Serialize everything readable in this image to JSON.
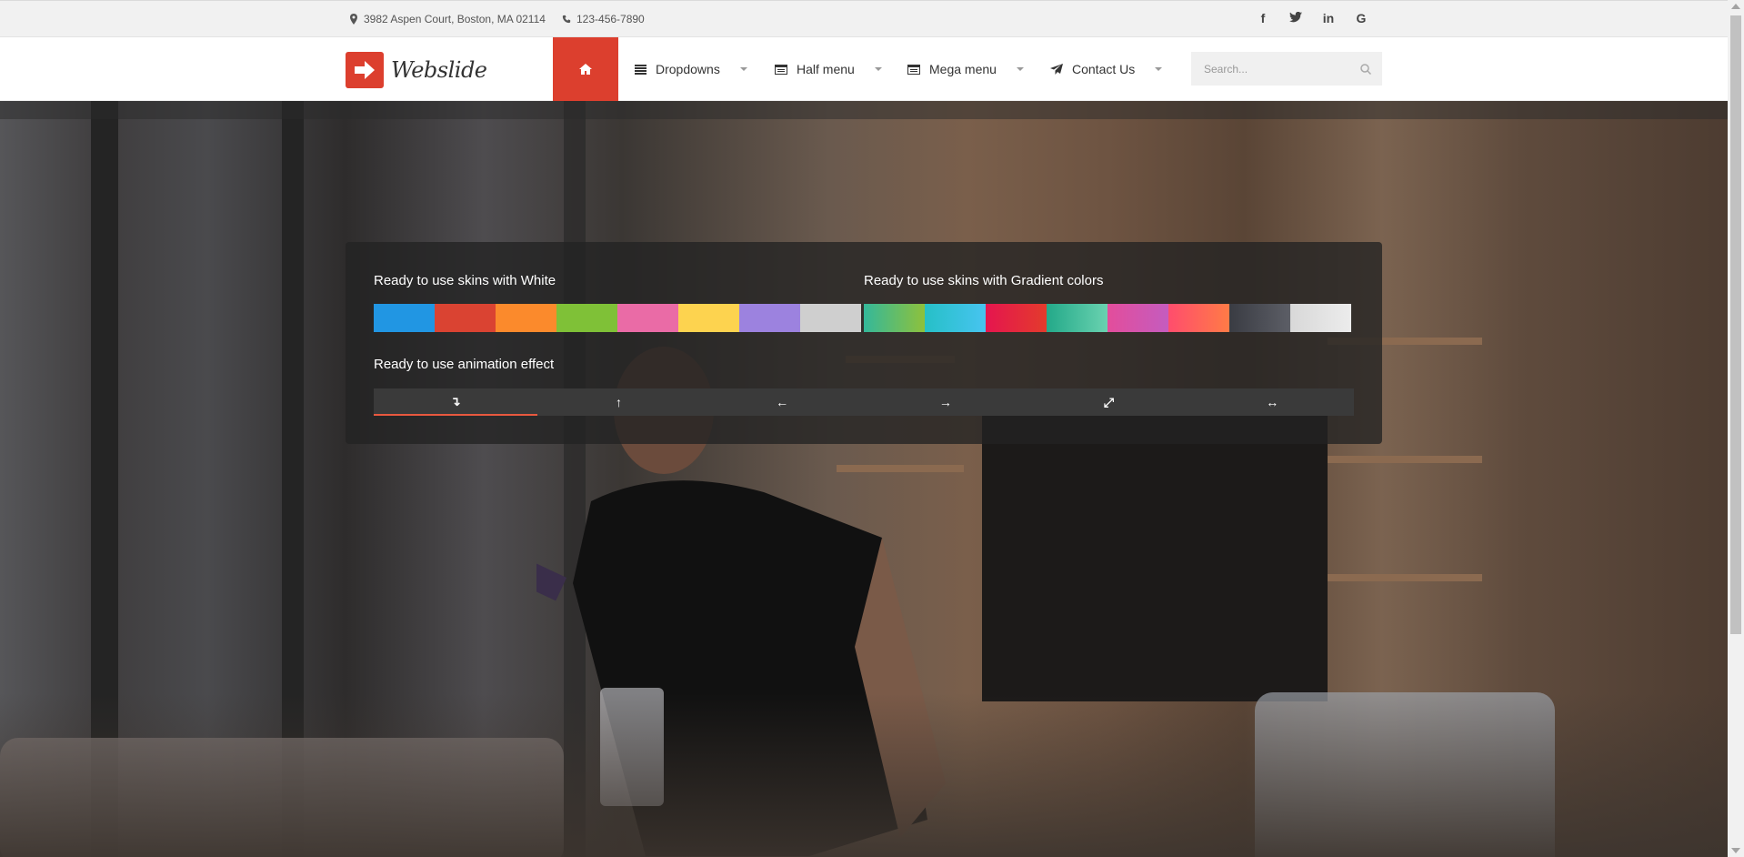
{
  "topbar": {
    "address": "3982 Aspen Court, Boston, MA 02114",
    "phone": "123-456-7890",
    "social": [
      "f",
      "t",
      "in",
      "G"
    ]
  },
  "nav": {
    "logo_text": "Webslide",
    "items": [
      {
        "label": "Dropdowns"
      },
      {
        "label": "Half menu"
      },
      {
        "label": "Mega menu"
      },
      {
        "label": "Contact Us"
      }
    ],
    "search_placeholder": "Search..."
  },
  "panel": {
    "white_label": "Ready to use skins with White",
    "gradient_label": "Ready to use skins with Gradient colors",
    "animation_label": "Ready to use animation effect",
    "white_skins": [
      "#2196e3",
      "#da4332",
      "#fb8a2c",
      "#7fc137",
      "#ea6ba6",
      "#fdd34f",
      "#9c82df",
      "#cfcfcf"
    ],
    "gradient_skins": [
      "linear-gradient(90deg,#34b89a,#8ec13c)",
      "linear-gradient(90deg,#26c0c7,#47c4f0)",
      "linear-gradient(90deg,#e5154f,#e33b2c)",
      "linear-gradient(90deg,#23a989,#6ad2b0)",
      "linear-gradient(90deg,#e34d9b,#c45cbf)",
      "linear-gradient(90deg,#ff4d6d,#ff7b46)",
      "linear-gradient(90deg,#3a3c43,#5c5e66)",
      "linear-gradient(90deg,#d8d8d8,#ececec)"
    ],
    "animation_effects": [
      "↴",
      "↑",
      "←",
      "→",
      "⤢",
      "↔"
    ]
  }
}
